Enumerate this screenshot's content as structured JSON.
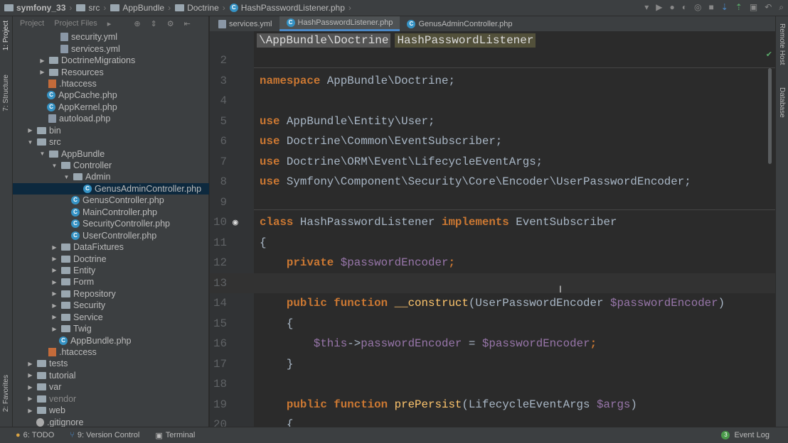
{
  "breadcrumb": [
    "symfony_33",
    "src",
    "AppBundle",
    "Doctrine",
    "HashPasswordListener.php"
  ],
  "project_panel": {
    "tab_project": "Project",
    "tab_files": "Project Files"
  },
  "left_strip": {
    "project": "1: Project",
    "structure": "7: Structure",
    "favorites": "2: Favorites"
  },
  "right_strip": {
    "remote": "Remote Host",
    "database": "Database"
  },
  "tree": [
    {
      "t": "security.yml",
      "d": 2,
      "k": "file"
    },
    {
      "t": "services.yml",
      "d": 2,
      "k": "file"
    },
    {
      "t": "DoctrineMigrations",
      "d": 1,
      "k": "closed"
    },
    {
      "t": "Resources",
      "d": 1,
      "k": "closed"
    },
    {
      "t": ".htaccess",
      "d": 1,
      "k": "ht"
    },
    {
      "t": "AppCache.php",
      "d": 1,
      "k": "php"
    },
    {
      "t": "AppKernel.php",
      "d": 1,
      "k": "php"
    },
    {
      "t": "autoload.php",
      "d": 1,
      "k": "file"
    },
    {
      "t": "bin",
      "d": 0,
      "k": "closed"
    },
    {
      "t": "src",
      "d": 0,
      "k": "open"
    },
    {
      "t": "AppBundle",
      "d": 1,
      "k": "open"
    },
    {
      "t": "Controller",
      "d": 2,
      "k": "open"
    },
    {
      "t": "Admin",
      "d": 3,
      "k": "open"
    },
    {
      "t": "GenusAdminController.php",
      "d": 4,
      "k": "php",
      "sel": true
    },
    {
      "t": "GenusController.php",
      "d": 3,
      "k": "php"
    },
    {
      "t": "MainController.php",
      "d": 3,
      "k": "php"
    },
    {
      "t": "SecurityController.php",
      "d": 3,
      "k": "php"
    },
    {
      "t": "UserController.php",
      "d": 3,
      "k": "php"
    },
    {
      "t": "DataFixtures",
      "d": 2,
      "k": "closed"
    },
    {
      "t": "Doctrine",
      "d": 2,
      "k": "closed"
    },
    {
      "t": "Entity",
      "d": 2,
      "k": "closed"
    },
    {
      "t": "Form",
      "d": 2,
      "k": "closed"
    },
    {
      "t": "Repository",
      "d": 2,
      "k": "closed"
    },
    {
      "t": "Security",
      "d": 2,
      "k": "closed"
    },
    {
      "t": "Service",
      "d": 2,
      "k": "closed"
    },
    {
      "t": "Twig",
      "d": 2,
      "k": "closed"
    },
    {
      "t": "AppBundle.php",
      "d": 2,
      "k": "php"
    },
    {
      "t": ".htaccess",
      "d": 1,
      "k": "ht"
    },
    {
      "t": "tests",
      "d": 0,
      "k": "closed"
    },
    {
      "t": "tutorial",
      "d": 0,
      "k": "closed"
    },
    {
      "t": "var",
      "d": 0,
      "k": "closed"
    },
    {
      "t": "vendor",
      "d": 0,
      "k": "closed",
      "dim": true
    },
    {
      "t": "web",
      "d": 0,
      "k": "closed"
    },
    {
      "t": ".gitignore",
      "d": 0,
      "k": "git"
    }
  ],
  "tabs": [
    {
      "label": "services.yml"
    },
    {
      "label": "HashPasswordListener.php",
      "active": true
    },
    {
      "label": "GenusAdminController.php"
    }
  ],
  "editor_breadcrumb": {
    "ns": "\\AppBundle\\Doctrine",
    "cls": "HashPasswordListener"
  },
  "code": [
    {
      "n": "2",
      "tok": []
    },
    {
      "n": "3",
      "tok": [
        [
          "k",
          "namespace"
        ],
        [
          "t",
          " AppBundle\\Doctrine;"
        ]
      ]
    },
    {
      "n": "4",
      "tok": []
    },
    {
      "n": "5",
      "tok": [
        [
          "k",
          "use"
        ],
        [
          "t",
          " AppBundle\\Entity\\User;"
        ]
      ]
    },
    {
      "n": "6",
      "tok": [
        [
          "k",
          "use"
        ],
        [
          "t",
          " Doctrine\\Common\\EventSubscriber;"
        ]
      ]
    },
    {
      "n": "7",
      "tok": [
        [
          "k",
          "use"
        ],
        [
          "t",
          " Doctrine\\ORM\\Event\\LifecycleEventArgs;"
        ]
      ]
    },
    {
      "n": "8",
      "tok": [
        [
          "k",
          "use"
        ],
        [
          "t",
          " Symfony\\Component\\Security\\Core\\Encoder\\UserPasswordEncoder;"
        ]
      ]
    },
    {
      "n": "9",
      "tok": []
    },
    {
      "n": "10",
      "tok": [
        [
          "k",
          "class"
        ],
        [
          "t",
          " HashPasswordListener "
        ],
        [
          "k",
          "implements"
        ],
        [
          "t",
          " EventSubscriber"
        ]
      ]
    },
    {
      "n": "11",
      "tok": [
        [
          "t",
          "{"
        ]
      ]
    },
    {
      "n": "12",
      "tok": [
        [
          "t",
          "    "
        ],
        [
          "k",
          "private"
        ],
        [
          "t",
          " "
        ],
        [
          "v",
          "$passwordEncoder"
        ],
        [
          "k",
          ";"
        ]
      ]
    },
    {
      "n": "13",
      "tok": []
    },
    {
      "n": "14",
      "tok": [
        [
          "t",
          "    "
        ],
        [
          "k",
          "public function"
        ],
        [
          "t",
          " "
        ],
        [
          "f",
          "__construct"
        ],
        [
          "t",
          "(UserPasswordEncoder "
        ],
        [
          "v",
          "$passwordEncoder"
        ],
        [
          "t",
          ")"
        ]
      ]
    },
    {
      "n": "15",
      "tok": [
        [
          "t",
          "    {"
        ]
      ]
    },
    {
      "n": "16",
      "tok": [
        [
          "t",
          "        "
        ],
        [
          "v",
          "$this"
        ],
        [
          "t",
          "->"
        ],
        [
          "v",
          "passwordEncoder"
        ],
        [
          "t",
          " = "
        ],
        [
          "v",
          "$passwordEncoder"
        ],
        [
          "k",
          ";"
        ]
      ]
    },
    {
      "n": "17",
      "tok": [
        [
          "t",
          "    }"
        ]
      ]
    },
    {
      "n": "18",
      "tok": []
    },
    {
      "n": "19",
      "tok": [
        [
          "t",
          "    "
        ],
        [
          "k",
          "public function"
        ],
        [
          "t",
          " "
        ],
        [
          "f",
          "prePersist"
        ],
        [
          "t",
          "(LifecycleEventArgs "
        ],
        [
          "v",
          "$args"
        ],
        [
          "t",
          ")"
        ]
      ]
    },
    {
      "n": "20",
      "tok": [
        [
          "t",
          "    {"
        ]
      ]
    }
  ],
  "status": {
    "todo": "6: TODO",
    "vcs": "9: Version Control",
    "terminal": "Terminal",
    "event_count": "3",
    "event_log": "Event Log"
  }
}
